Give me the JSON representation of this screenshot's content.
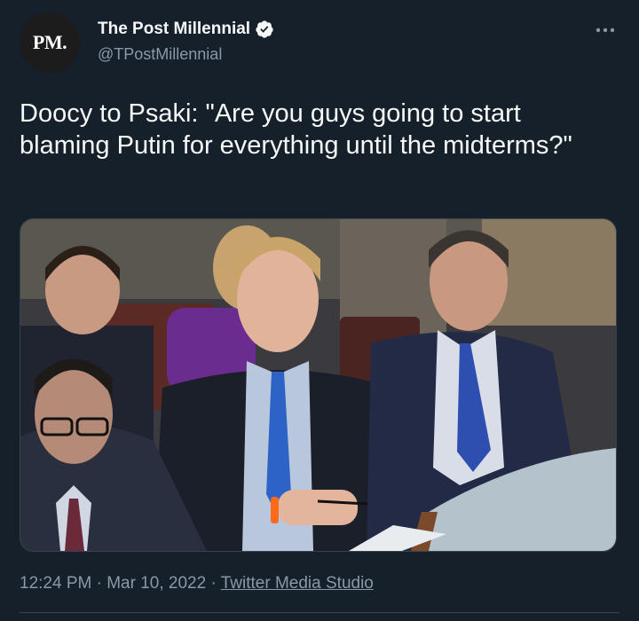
{
  "author": {
    "avatar_text": "PM.",
    "name": "The Post Millennial",
    "handle": "@TPostMillennial",
    "verified": true
  },
  "tweet": {
    "text": "Doocy to Psaki: \"Are you guys going to start blaming Putin for everything until the midterms?\""
  },
  "meta": {
    "time": "12:24 PM",
    "separator": " · ",
    "date": "Mar 10, 2022",
    "source": "Twitter Media Studio"
  },
  "icons": {
    "more": "more-options-icon",
    "verified": "verified-badge-icon"
  },
  "colors": {
    "background": "#15202b",
    "text": "#f7f9f9",
    "secondary": "#8b98a5",
    "border": "#38444d"
  }
}
